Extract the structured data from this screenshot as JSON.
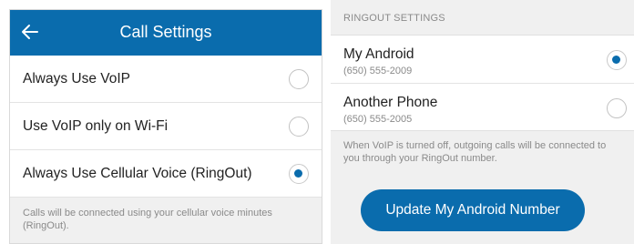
{
  "call_settings": {
    "title": "Call Settings",
    "back_icon": "back-arrow-icon",
    "options": [
      {
        "label": "Always Use VoIP",
        "selected": false
      },
      {
        "label": "Use VoIP only on Wi-Fi",
        "selected": false
      },
      {
        "label": "Always Use Cellular Voice (RingOut)",
        "selected": true
      }
    ],
    "footer_note": "Calls will be connected using your cellular voice minutes (RingOut)."
  },
  "ringout_settings": {
    "header": "RINGOUT SETTINGS",
    "phones": [
      {
        "name": "My Android",
        "number": "(650) 555-2009",
        "selected": true
      },
      {
        "name": "Another Phone",
        "number": "(650) 555-2005",
        "selected": false
      }
    ],
    "note": "When VoIP is turned off, outgoing calls will be connected to you through your RingOut number.",
    "update_button_label": "Update My Android Number"
  },
  "colors": {
    "accent": "#0a6cad",
    "background": "#f0f0f0",
    "secondary_text": "#8a8a8a"
  }
}
